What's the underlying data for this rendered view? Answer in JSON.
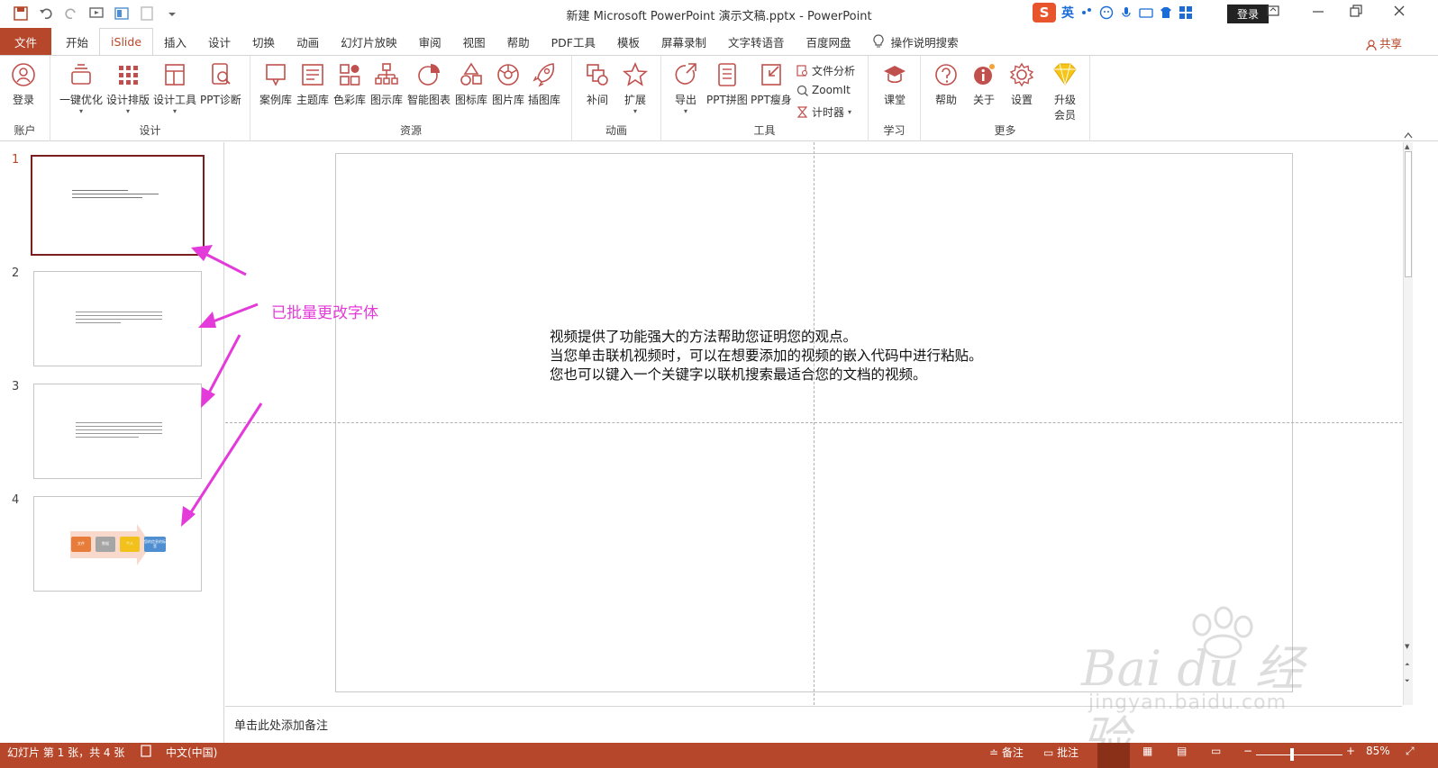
{
  "window": {
    "title": "新建 Microsoft PowerPoint 演示文稿.pptx  -  PowerPoint",
    "login_label": "登录",
    "ime_language": "英"
  },
  "tabs": [
    {
      "label": "文件"
    },
    {
      "label": "开始"
    },
    {
      "label": "iSlide"
    },
    {
      "label": "插入"
    },
    {
      "label": "设计"
    },
    {
      "label": "切换"
    },
    {
      "label": "动画"
    },
    {
      "label": "幻灯片放映"
    },
    {
      "label": "审阅"
    },
    {
      "label": "视图"
    },
    {
      "label": "帮助"
    },
    {
      "label": "PDF工具"
    },
    {
      "label": "模板"
    },
    {
      "label": "屏幕录制"
    },
    {
      "label": "文字转语音"
    },
    {
      "label": "百度网盘"
    },
    {
      "label": "操作说明搜索"
    }
  ],
  "share_label": "共享",
  "ribbon": {
    "groups": {
      "account": "账户",
      "design": "设计",
      "resources": "资源",
      "animation": "动画",
      "tools": "工具",
      "learn": "学习",
      "more": "更多"
    },
    "buttons": {
      "login": "登录",
      "one_click": "一键优化",
      "design_layout": "设计排版",
      "design_tools": "设计工具",
      "ppt_diagnose": "PPT诊断",
      "case_lib": "案例库",
      "theme_lib": "主题库",
      "color_lib": "色彩库",
      "diagram_lib": "图示库",
      "smart_chart": "智能图表",
      "icon_lib": "图标库",
      "picture_lib": "图片库",
      "illustration_lib": "插图库",
      "tween": "补间",
      "expand": "扩展",
      "export": "导出",
      "ppt_puzzle": "PPT拼图",
      "ppt_slim": "PPT瘦身",
      "file_analysis": "文件分析",
      "zoomit": "ZoomIt",
      "timer": "计时器",
      "classroom": "课堂",
      "help": "帮助",
      "about": "关于",
      "settings": "设置",
      "upgrade_line1": "升级",
      "upgrade_line2": "会员"
    }
  },
  "thumbnails": [
    {
      "number": "1",
      "selected": true
    },
    {
      "number": "2",
      "selected": false
    },
    {
      "number": "3",
      "selected": false
    },
    {
      "number": "4",
      "selected": false
    }
  ],
  "slide4_boxes": [
    {
      "label": "文件",
      "color": "#e87c3a"
    },
    {
      "label": "数据",
      "color": "#a5a5a5"
    },
    {
      "label": "个人",
      "color": "#f2c11b"
    },
    {
      "label": "您的信息的标签",
      "color": "#4f8ed1"
    }
  ],
  "annotation": {
    "text": "已批量更改字体",
    "color": "#e33ad9"
  },
  "slide": {
    "lines": [
      "视频提供了功能强大的方法帮助您证明您的观点。",
      "当您单击联机视频时，可以在想要添加的视频的嵌入代码中进行粘贴。",
      "您也可以键入一个关键字以联机搜索最适合您的文档的视频。"
    ]
  },
  "notes_placeholder": "单击此处添加备注",
  "status": {
    "slide_info": "幻灯片 第 1 张，共 4 张",
    "language": "中文(中国)",
    "notes": "备注",
    "comments": "批注",
    "zoom": "85%"
  },
  "watermark": {
    "main": "Bai du 经验",
    "sub": "jingyan.baidu.com"
  },
  "colors": {
    "accent": "#b7472a",
    "selected_border": "#7a1e1e",
    "annotation": "#e33ad9"
  }
}
